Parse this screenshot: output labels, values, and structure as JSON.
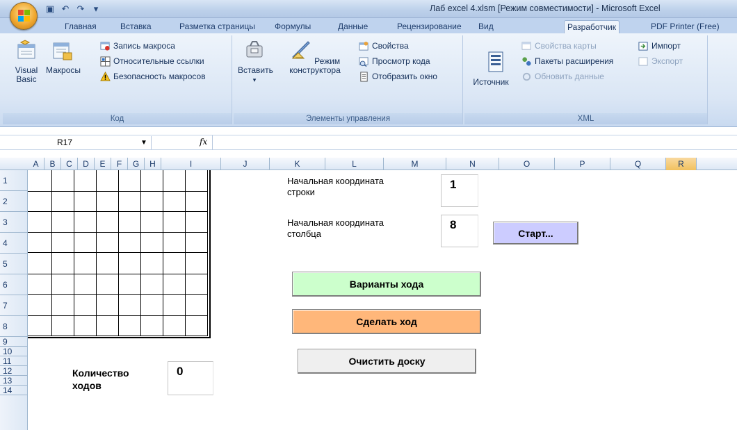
{
  "window": {
    "title": "Лаб excel 4.xlsm  [Режим совместимости] - Microsoft Excel"
  },
  "tabs": [
    "Главная",
    "Вставка",
    "Разметка страницы",
    "Формулы",
    "Данные",
    "Рецензирование",
    "Вид",
    "Разработчик",
    "PDF Printer (Free)"
  ],
  "active_tab": "Разработчик",
  "ribbon": {
    "code": {
      "label": "Код",
      "visual_basic": "Visual Basic",
      "macros": "Макросы",
      "record_macro": "Запись макроса",
      "relative_refs": "Относительные ссылки",
      "macro_security": "Безопасность макросов"
    },
    "controls": {
      "label": "Элементы управления",
      "insert": "Вставить",
      "design_mode_1": "Режим",
      "design_mode_2": "конструктора",
      "properties": "Свойства",
      "view_code": "Просмотр кода",
      "show_window": "Отобразить окно"
    },
    "xml": {
      "label": "XML",
      "source": "Источник",
      "map_properties": "Свойства карты",
      "expansion_packs": "Пакеты расширения",
      "refresh_data": "Обновить данные",
      "import": "Импорт",
      "export": "Экспорт"
    }
  },
  "formula_bar": {
    "name_box": "R17",
    "fx": "fx",
    "value": ""
  },
  "columns": [
    "A",
    "B",
    "C",
    "D",
    "E",
    "F",
    "G",
    "H",
    "I",
    "J",
    "K",
    "L",
    "M",
    "N",
    "O",
    "P",
    "Q",
    "R"
  ],
  "selected_column": "R",
  "rows": [
    "1",
    "2",
    "3",
    "4",
    "5",
    "6",
    "7",
    "8",
    "9",
    "10",
    "11",
    "12",
    "13",
    "14"
  ],
  "sheet": {
    "start_row_label_1": "Начальная координата",
    "start_row_label_2": "строки",
    "start_row_value": "1",
    "start_col_label_1": "Начальная координата",
    "start_col_label_2": "столбца",
    "start_col_value": "8",
    "start_button": "Старт...",
    "variants_button": "Варианты хода",
    "make_move_button": "Сделать ход",
    "clear_button": "Очистить доску",
    "moves_label_1": "Количество",
    "moves_label_2": "ходов",
    "moves_value": "0"
  },
  "colors": {
    "start_button": "#ccccff",
    "variants_button": "#ccffcc",
    "make_move_button": "#ffb77a",
    "clear_button": "#efefef",
    "selected_header": "#f1c15f"
  }
}
